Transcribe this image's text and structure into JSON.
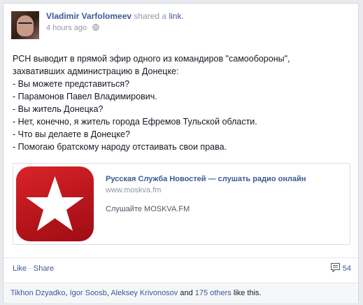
{
  "post": {
    "author": "Vladimir Varfolomeev",
    "action_text": "shared a",
    "action_link": "link.",
    "timestamp": "4 hours ago",
    "body_lines": [
      "РСН выводит в прямой эфир одного из командиров \"самообороны\",",
      "захвативших администрацию в Донецке:",
      "- Вы можете представиться?",
      "- Парамонов Павел Владимирович.",
      "- Вы житель Донецка?",
      "- Нет, конечно, я житель города Ефремов Тульской области.",
      "- Что вы делаете в Донецке?",
      "- Помогаю братскому народу отстаивать свои права."
    ]
  },
  "attachment": {
    "title": "Русская Служба Новостей — слушать радио онлайн",
    "url": "www.moskva.fm",
    "description": "Слушайте MOSKVA.FM",
    "thumb_icon": "red-star-logo"
  },
  "actions": {
    "like": "Like",
    "separator": "·",
    "share": "Share",
    "comment_count": "54",
    "comment_icon": "comment-icon"
  },
  "likes": {
    "names": [
      "Tikhon Dzyadko",
      "Igor Soosb",
      "Aleksey Krivonosov"
    ],
    "comma": ",",
    "and": "and",
    "others": "175 others",
    "suffix": "like this."
  },
  "colors": {
    "link": "#3b5998",
    "muted": "#9197a3",
    "accent_red": "#d9242a"
  }
}
